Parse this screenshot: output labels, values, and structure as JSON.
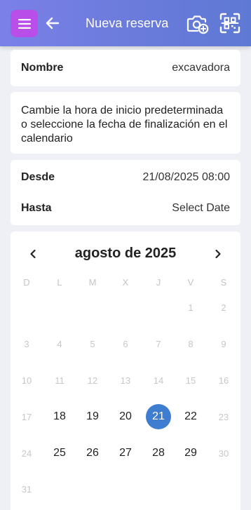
{
  "header": {
    "title": "Nueva reserva",
    "colors": {
      "gradient_start": "#7b80e8",
      "gradient_end": "#5e79d4",
      "menu_button": "#b94ee8"
    },
    "icons": [
      "menu-icon",
      "arrow-left-icon",
      "camera-add-icon",
      "qr-scan-icon"
    ]
  },
  "name_field": {
    "label": "Nombre",
    "value": "excavadora"
  },
  "info": {
    "text": "Cambie la hora de inicio predeterminada o seleccione la fecha de finalización en el calendario"
  },
  "dates": {
    "from_label": "Desde",
    "from_value": "21/08/2025 08:00",
    "to_label": "Hasta",
    "to_value": "Select Date"
  },
  "calendar": {
    "month_title": "agosto de 2025",
    "weekdays": [
      "D",
      "L",
      "M",
      "X",
      "J",
      "V",
      "S"
    ],
    "weeks": [
      [
        null,
        null,
        null,
        null,
        null,
        "1",
        "2"
      ],
      [
        "3",
        "4",
        "5",
        "6",
        "7",
        "8",
        "9"
      ],
      [
        "10",
        "11",
        "12",
        "13",
        "14",
        "15",
        "16"
      ],
      [
        "17",
        "18",
        "19",
        "20",
        "21",
        "22",
        "23"
      ],
      [
        "24",
        "25",
        "26",
        "27",
        "28",
        "29",
        "30"
      ],
      [
        "31",
        null,
        null,
        null,
        null,
        null,
        null
      ]
    ],
    "enabled_days": [
      "18",
      "19",
      "20",
      "21",
      "22",
      "25",
      "26",
      "27",
      "28",
      "29"
    ],
    "selected_day": "21",
    "selected_color": "#3f7dd1"
  }
}
